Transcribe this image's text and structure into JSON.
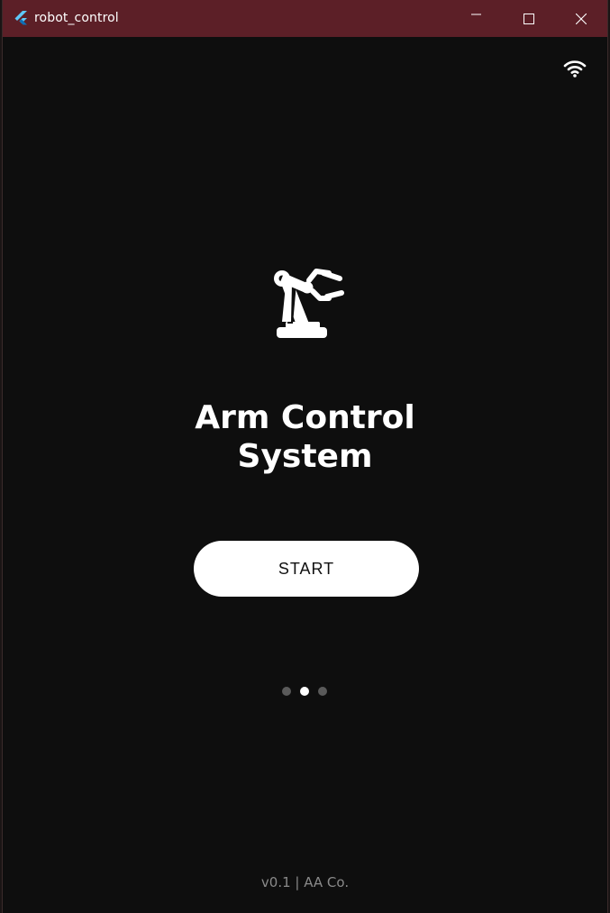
{
  "window": {
    "title": "robot_control",
    "titlebar_color": "#5c1f27",
    "background": "#0e0e0e"
  },
  "status": {
    "wifi_icon": "wifi-icon"
  },
  "hero": {
    "icon": "robot-arm-icon",
    "title_line1": "Arm Control",
    "title_line2": "System"
  },
  "actions": {
    "start_label": "START"
  },
  "pagination": {
    "pages": 3,
    "active_index": 1
  },
  "footer": {
    "text": "v0.1 | AA Co."
  }
}
